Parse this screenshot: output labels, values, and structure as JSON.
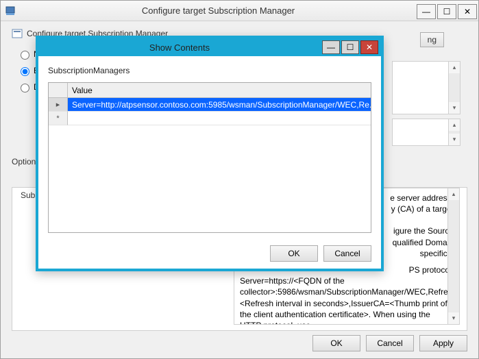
{
  "parent": {
    "title": "Configure target Subscription Manager",
    "header_text": "Configure target Subscription Manager",
    "radios": {
      "not_configured": "Not Configured",
      "enabled": "Enabled",
      "disabled": "Disabled"
    },
    "options_label": "Options:",
    "help_label": "Subsc",
    "peek_button": "ng",
    "help_text_1": "e server address,",
    "help_text_2": "y (CA) of a target",
    "help_text_3": "igure the Source",
    "help_text_4": "qualified Domain",
    "help_text_5": " specifics.",
    "help_text_6": "PS protocol:",
    "help_text_7": "Server=https://<FQDN of the collector>:5986/wsman/SubscriptionManager/WEC,Refresh=<Refresh interval in seconds>,IssuerCA=<Thumb print of the client authentication certificate>. When using the HTTP protocol, use",
    "footer": {
      "ok": "OK",
      "cancel": "Cancel",
      "apply": "Apply"
    }
  },
  "modal": {
    "title": "Show Contents",
    "label": "SubscriptionManagers",
    "column": "Value",
    "row_marker_current": "▸",
    "row_marker_new": "*",
    "value1": "Server=http://atpsensor.contoso.com:5985/wsman/SubscriptionManager/WEC,Re...",
    "footer": {
      "ok": "OK",
      "cancel": "Cancel"
    }
  }
}
